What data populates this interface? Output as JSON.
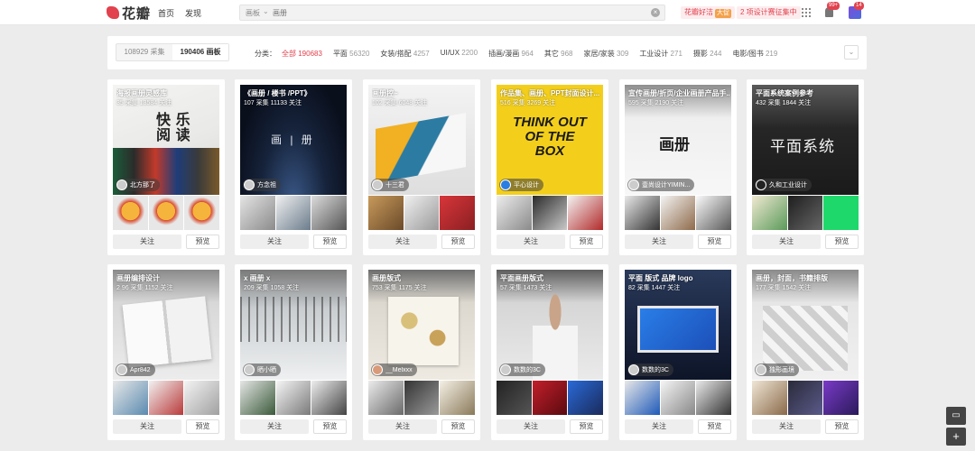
{
  "header": {
    "logo_text": "花瓣",
    "nav": [
      {
        "label": "首页"
      },
      {
        "label": "发现"
      }
    ],
    "search": {
      "scope": "画板",
      "placeholder": "画册"
    },
    "promo1": {
      "label": "花瓣好洁",
      "badge": "大促"
    },
    "promo2": {
      "label": "2 项设计赛征集中"
    },
    "notif_badge": "99+",
    "avatar_badge": "14"
  },
  "filter": {
    "toggles": [
      {
        "label": "108929 采集"
      },
      {
        "label": "190406 画板"
      }
    ],
    "category_head": "分类：",
    "categories": [
      {
        "label": "全部",
        "count": "190683"
      },
      {
        "label": "平面",
        "count": "56320"
      },
      {
        "label": "女装/搭配",
        "count": "4257"
      },
      {
        "label": "UI/UX",
        "count": "2200"
      },
      {
        "label": "插画/漫画",
        "count": "964"
      },
      {
        "label": "其它",
        "count": "968"
      },
      {
        "label": "家居/家装",
        "count": "309"
      },
      {
        "label": "工业设计",
        "count": "271"
      },
      {
        "label": "摄影",
        "count": "244"
      },
      {
        "label": "电影/图书",
        "count": "219"
      }
    ],
    "expand_icon": "chevron-down-icon"
  },
  "boards": [
    {
      "title": "海报画册灵感库",
      "stats": "35 采集  13584 关注",
      "owner": "北方那了",
      "follow": "关注",
      "preview": "预览",
      "cover_word": "快 乐 阅 读"
    },
    {
      "title": "《画册 / 楼书 /PPT》",
      "stats": "107 采集  11133 关注",
      "owner": "方念祖",
      "follow": "关注",
      "preview": "预览",
      "cover_word": "画 | 册"
    },
    {
      "title": "画册控~",
      "stats": "102 采集  6048 关注",
      "owner": "十三君",
      "follow": "关注",
      "preview": "预览",
      "cover_word": ""
    },
    {
      "title": "作品集、画册、PPT封面设计...",
      "stats": "516 采集  3269 关注",
      "owner": "平心设计",
      "follow": "关注",
      "preview": "预览",
      "cover_word": "THINK OUT OF THE BOX"
    },
    {
      "title": "宣传画册/折页/企业画册产品手...",
      "stats": "595 采集  2190 关注",
      "owner": "壹尚设计YIMIN...",
      "follow": "关注",
      "preview": "预览",
      "cover_word": "画册"
    },
    {
      "title": "平面系统案例参考",
      "stats": "432 采集  1844 关注",
      "owner": "久和工业设计",
      "follow": "关注",
      "preview": "预览",
      "cover_word": "平面系统"
    },
    {
      "title": "画册编排设计",
      "stats": "2 96 采集  1152 关注",
      "owner": "Apr842",
      "follow": "关注",
      "preview": "预览",
      "cover_word": ""
    },
    {
      "title": "x 画册 x",
      "stats": "209 采集  1058 关注",
      "owner": "晒小晒",
      "follow": "关注",
      "preview": "预览",
      "cover_word": ""
    },
    {
      "title": "画册版式",
      "stats": "753 采集  1175 关注",
      "owner": "__Melxxx",
      "follow": "关注",
      "preview": "预览",
      "cover_word": ""
    },
    {
      "title": "平面画册版式",
      "stats": "57 采集  1473 关注",
      "owner": "数数的3C",
      "follow": "关注",
      "preview": "预览",
      "cover_word": ""
    },
    {
      "title": "平面 版式 品牌 logo",
      "stats": "82 采集  1447 关注",
      "owner": "数数的3C",
      "follow": "关注",
      "preview": "预览",
      "cover_word": ""
    },
    {
      "title": "画册，封面，书籍排版",
      "stats": "177 采集  1542 关注",
      "owner": "独形画境",
      "follow": "关注",
      "preview": "预览",
      "cover_word": ""
    }
  ],
  "float": {
    "chat_icon": "chat-icon",
    "add_icon": "plus-icon"
  }
}
